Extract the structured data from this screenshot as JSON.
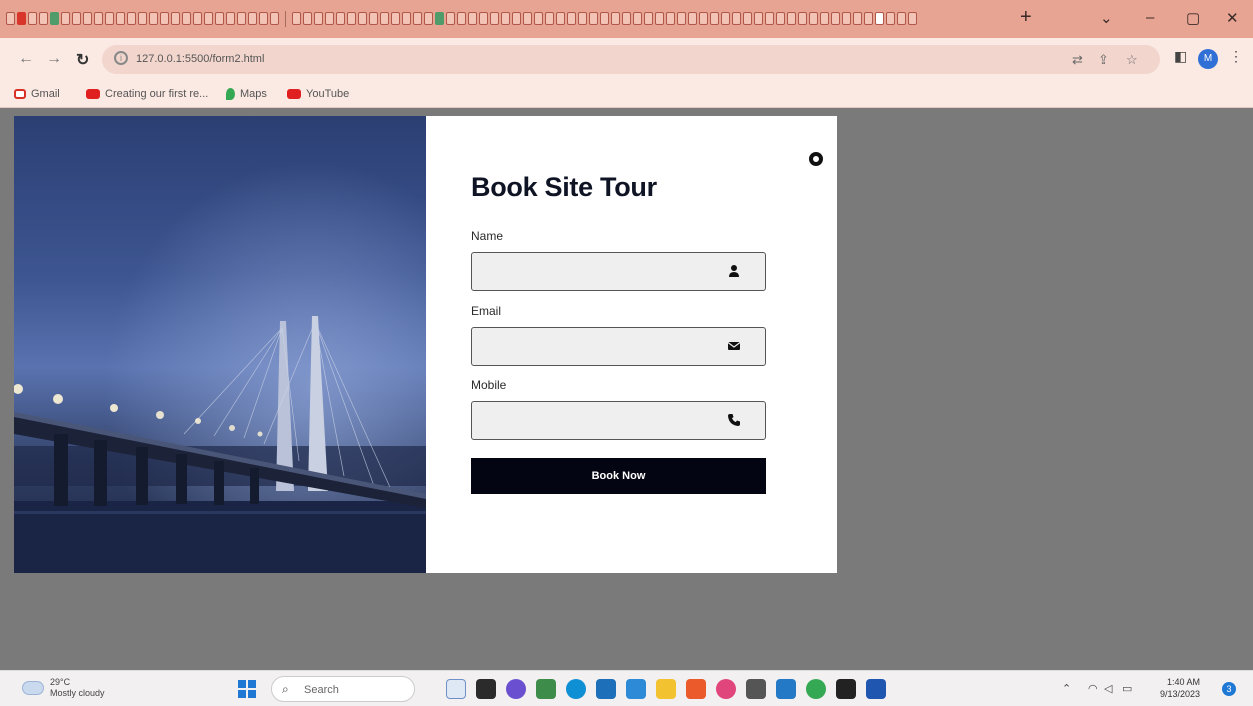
{
  "browser": {
    "url": "127.0.0.1:5500/form2.html",
    "new_tab_label": "+",
    "window_controls": {
      "chevron": "⌄",
      "minimize": "–",
      "restore": "▢",
      "close": "✕"
    },
    "bookmarks": [
      {
        "label": "Gmail",
        "icon": "gmail-icon",
        "color": "#d93025"
      },
      {
        "label": "Creating our first re...",
        "icon": "youtube-icon",
        "color": "#e02020"
      },
      {
        "label": "Maps",
        "icon": "maps-icon",
        "color": "#34a853"
      },
      {
        "label": "YouTube",
        "icon": "youtube-icon",
        "color": "#e02020"
      }
    ],
    "profile_initial": "M"
  },
  "form": {
    "title": "Book Site Tour",
    "fields": {
      "name": {
        "label": "Name",
        "value": "",
        "icon": "user-icon"
      },
      "email": {
        "label": "Email",
        "value": "",
        "icon": "envelope-icon"
      },
      "mobile": {
        "label": "Mobile",
        "value": "",
        "icon": "phone-icon"
      }
    },
    "submit_label": "Book Now",
    "close_icon": "close-circle-icon",
    "button_color": "#030513"
  },
  "taskbar": {
    "weather_temp": "29°C",
    "weather_desc": "Mostly cloudy",
    "search_label": "Search",
    "clock_time": "1:40 AM",
    "clock_date": "9/13/2023",
    "notification_count": "3"
  }
}
